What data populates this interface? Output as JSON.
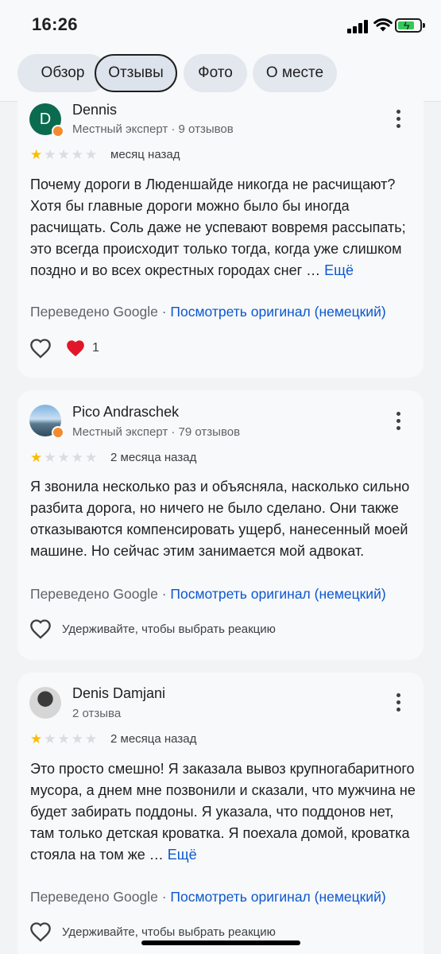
{
  "status_bar": {
    "time": "16:26"
  },
  "tabs": [
    {
      "label": "Обзор",
      "active": false
    },
    {
      "label": "Отзывы",
      "active": true
    },
    {
      "label": "Фото",
      "active": false
    },
    {
      "label": "О месте",
      "active": false
    }
  ],
  "reviews": [
    {
      "name": "Dennis",
      "avatar_letter": "D",
      "avatar_color": "#0b6b4e",
      "meta": "Местный эксперт · 9 отзывов",
      "rating": 1,
      "date": "месяц назад",
      "text": "Почему дороги в Люденшайде никогда не расчищают? Хотя бы главные дороги можно было бы иногда расчищать. Соль даже не успевают вовремя рассыпать; это всегда происходит только тогда, когда уже слишком поздно и во всех окрестных городах снег …",
      "more": "Ещё",
      "translated_prefix": "Переведено Google",
      "translated_link": "Посмотреть оригинал (немецкий)",
      "reaction_count": "1"
    },
    {
      "name": "Pico Andraschek",
      "meta": "Местный эксперт · 79 отзывов",
      "rating": 1,
      "date": "2 месяца назад",
      "text": "Я звонила несколько раз и объясняла, насколько сильно разбита дорога, но ничего не было сделано. Они также отказываются компенсировать ущерб, нанесенный моей машине. Но сейчас этим занимается мой адвокат.",
      "translated_prefix": "Переведено Google",
      "translated_link": "Посмотреть оригинал (немецкий)",
      "hold_hint": "Удерживайте, чтобы выбрать реакцию"
    },
    {
      "name": "Denis Damjani",
      "meta": "2 отзыва",
      "rating": 1,
      "date": "2 месяца назад",
      "text": "Это просто смешно! Я заказала вывоз крупногабаритного мусора, а днем мне позвонили и сказали, что мужчина не будет забирать поддоны. Я указала, что поддонов нет, там только детская кроватка. Я поехала домой, кроватка стояла на том же …",
      "more": "Ещё",
      "translated_prefix": "Переведено Google",
      "translated_link": "Посмотреть оригинал (немецкий)",
      "hold_hint": "Удерживайте, чтобы выбрать реакцию"
    }
  ],
  "colors": {
    "link": "#0b57d0",
    "star": "#fbbc04",
    "heart": "#e2162a",
    "badge": "#f28b30"
  }
}
